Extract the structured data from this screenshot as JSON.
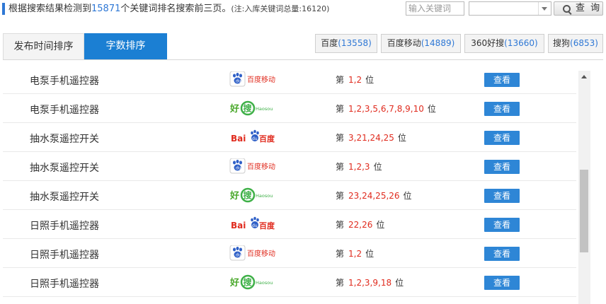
{
  "header": {
    "text_before": "根据搜索结果检测到",
    "keyword_count": "15871",
    "text_after": "个关键词排名搜索前三页。",
    "note": "(注:入库关键词总量:16120)"
  },
  "search": {
    "placeholder": "输入关键词",
    "engine_value": "",
    "button_label": "查 询"
  },
  "sort_tabs": [
    "发布时间排序",
    "字数排序"
  ],
  "active_sort": "字数排序",
  "engine_tabs": [
    {
      "name": "百度",
      "count": "(13558)"
    },
    {
      "name": "百度移动",
      "count": "(14889)"
    },
    {
      "name": "360好搜",
      "count": "(13660)"
    },
    {
      "name": "搜狗",
      "count": "(6853)"
    }
  ],
  "logo_texts": {
    "baidu_mobile": "百度移动",
    "haosou_cn": "好",
    "haosou_mid": "搜",
    "haosou_en": "Haosou",
    "baidu_en1": "Bai",
    "baidu_paw": "du",
    "baidu_cn": "百度"
  },
  "rank_prefix": "第",
  "rank_suffix": "位",
  "view_label": "查看",
  "rows": [
    {
      "keyword": "电泵手机遥控器",
      "engine": "baidu-mobile",
      "positions": "1,2"
    },
    {
      "keyword": "电泵手机遥控器",
      "engine": "haosou",
      "positions": "1,2,3,5,6,7,8,9,10"
    },
    {
      "keyword": "抽水泵遥控开关",
      "engine": "baidu",
      "positions": "3,21,24,25"
    },
    {
      "keyword": "抽水泵遥控开关",
      "engine": "baidu-mobile",
      "positions": "1,2,3"
    },
    {
      "keyword": "抽水泵遥控开关",
      "engine": "haosou",
      "positions": "23,24,25,26"
    },
    {
      "keyword": "日照手机遥控器",
      "engine": "baidu",
      "positions": "22,26"
    },
    {
      "keyword": "日照手机遥控器",
      "engine": "baidu-mobile",
      "positions": "1,2"
    },
    {
      "keyword": "日照手机遥控器",
      "engine": "haosou",
      "positions": "1,2,3,9,18"
    }
  ],
  "colors": {
    "accent": "#2f78d5",
    "active_tab": "#1b7fd3",
    "button": "#2e86d6",
    "rank": "#e02b1e"
  }
}
